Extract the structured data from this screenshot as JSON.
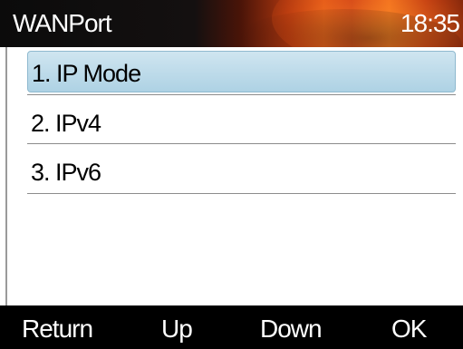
{
  "header": {
    "title": "WANPort",
    "time": "18:35"
  },
  "menu": {
    "items": [
      {
        "label": "1. IP Mode",
        "selected": true
      },
      {
        "label": "2. IPv4",
        "selected": false
      },
      {
        "label": "3. IPv6",
        "selected": false
      }
    ]
  },
  "softkeys": {
    "return": "Return",
    "up": "Up",
    "down": "Down",
    "ok": "OK"
  },
  "colors": {
    "selection": "#b9dbea",
    "header_accent": "#e0601c"
  }
}
